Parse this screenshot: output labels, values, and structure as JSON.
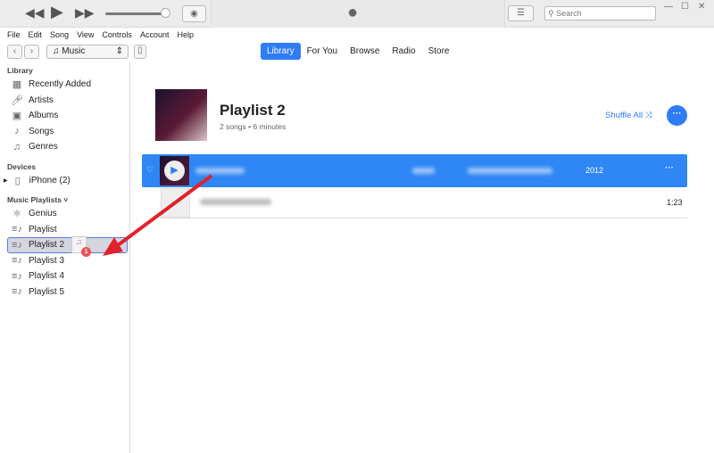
{
  "player": {
    "rewind": "◀◀",
    "play": "▶",
    "forward": "▶▶",
    "search_placeholder": "Search"
  },
  "menu": [
    "File",
    "Edit",
    "Song",
    "View",
    "Controls",
    "Account",
    "Help"
  ],
  "nav": {
    "source": "Music",
    "tabs": [
      "Library",
      "For You",
      "Browse",
      "Radio",
      "Store"
    ],
    "active_tab": "Library"
  },
  "sidebar": {
    "library_title": "Library",
    "library": [
      "Recently Added",
      "Artists",
      "Albums",
      "Songs",
      "Genres"
    ],
    "devices_title": "Devices",
    "device": "iPhone (2)",
    "playlists_title": "Music Playlists ˅",
    "playlists": [
      "Genius",
      "Playlist",
      "Playlist 2",
      "Playlist 3",
      "Playlist 4",
      "Playlist 5"
    ],
    "selected": "Playlist 2",
    "drag_badge": "1"
  },
  "playlist": {
    "title": "Playlist 2",
    "subtitle": "2 songs • 6 minutes",
    "shuffle": "Shuffle All",
    "songs": [
      {
        "year": "2012"
      },
      {
        "time": "1:23"
      }
    ]
  },
  "colors": {
    "accent": "#2e7cf6",
    "arrow": "#e0222a"
  }
}
